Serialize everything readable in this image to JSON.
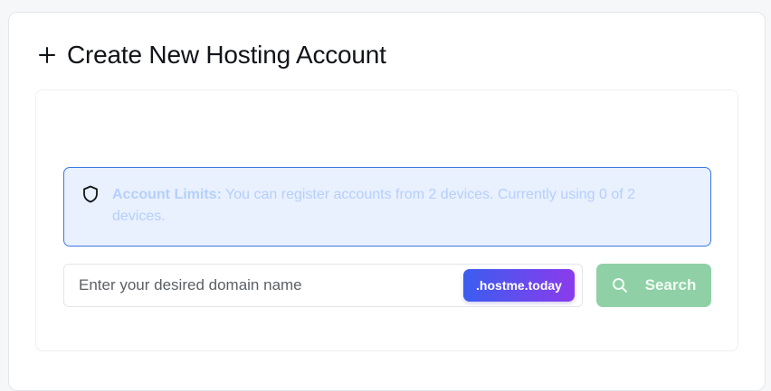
{
  "header": {
    "title": "Create New Hosting Account",
    "icon": "plus-icon"
  },
  "alert": {
    "icon": "shield-icon",
    "label": "Account Limits:",
    "message": " You can register accounts from 2 devices. Currently using 0 of 2 devices.",
    "colors": {
      "background": "#e9f0fe",
      "border": "#3d78e6",
      "text": "#b5d0fb"
    }
  },
  "domain": {
    "placeholder": "Enter your desired domain name",
    "value": "",
    "suffix": ".hostme.today"
  },
  "search": {
    "label": "Search",
    "icon": "search-icon",
    "color": "#8fd0a6"
  }
}
